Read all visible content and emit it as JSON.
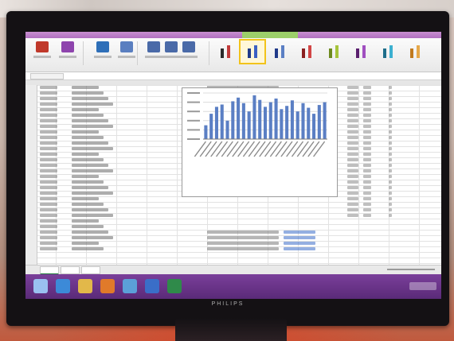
{
  "colors": {
    "accent_excel_green": "#1f7a3a",
    "chart_bar": "#5b7fc4",
    "taskbar": "#6a3488",
    "selected_gallery": "#f2c31b"
  },
  "ribbon": {
    "buttons": [
      {
        "icon": "change-chart-type-icon"
      },
      {
        "icon": "save-as-template-icon"
      },
      {
        "icon": "switch-row-column-icon"
      },
      {
        "icon": "select-data-icon"
      },
      {
        "icon": "layout-1-icon"
      },
      {
        "icon": "layout-2-icon"
      },
      {
        "icon": "layout-3-icon"
      }
    ],
    "chart_styles": [
      {
        "bars": [
          "#2b2b2b",
          "#c23b3b"
        ]
      },
      {
        "bars": [
          "#203a8a",
          "#3c61c2"
        ],
        "selected": true
      },
      {
        "bars": [
          "#203a8a",
          "#5b7fc4"
        ]
      },
      {
        "bars": [
          "#8a1f1f",
          "#d24545"
        ]
      },
      {
        "bars": [
          "#6e8a1f",
          "#a6c43c"
        ]
      },
      {
        "bars": [
          "#5a1f6e",
          "#a04fc0"
        ]
      },
      {
        "bars": [
          "#1f6e8a",
          "#3cb0d0"
        ]
      },
      {
        "bars": [
          "#c07a1f",
          "#e6a84a"
        ]
      }
    ]
  },
  "chart_data": {
    "type": "bar",
    "categories": [
      "",
      "",
      "",
      "",
      "",
      "",
      "",
      "",
      "",
      "",
      "",
      "",
      "",
      "",
      "",
      "",
      "",
      "",
      "",
      "",
      "",
      "",
      ""
    ],
    "series": [
      {
        "values": [
          30,
          55,
          70,
          75,
          40,
          82,
          90,
          78,
          60,
          95,
          85,
          70,
          80,
          88,
          65,
          72,
          84,
          60,
          78,
          68,
          55,
          74,
          80
        ]
      }
    ],
    "ylim": [
      0,
      100
    ],
    "grid": true
  },
  "statusbar": {
    "sheets": [
      {
        "active": true
      },
      {
        "active": false
      },
      {
        "active": false
      }
    ]
  },
  "taskbar": {
    "items": [
      {
        "icon": "start-icon",
        "color": "#9ac0f0"
      },
      {
        "icon": "ie-icon",
        "color": "#3c8ad8"
      },
      {
        "icon": "explorer-icon",
        "color": "#e2b84a"
      },
      {
        "icon": "media-icon",
        "color": "#e07a2a"
      },
      {
        "icon": "app-icon",
        "color": "#5ba0d8"
      },
      {
        "icon": "word-icon",
        "color": "#3a6ec8"
      },
      {
        "icon": "excel-icon",
        "color": "#2f8a4a"
      }
    ]
  }
}
